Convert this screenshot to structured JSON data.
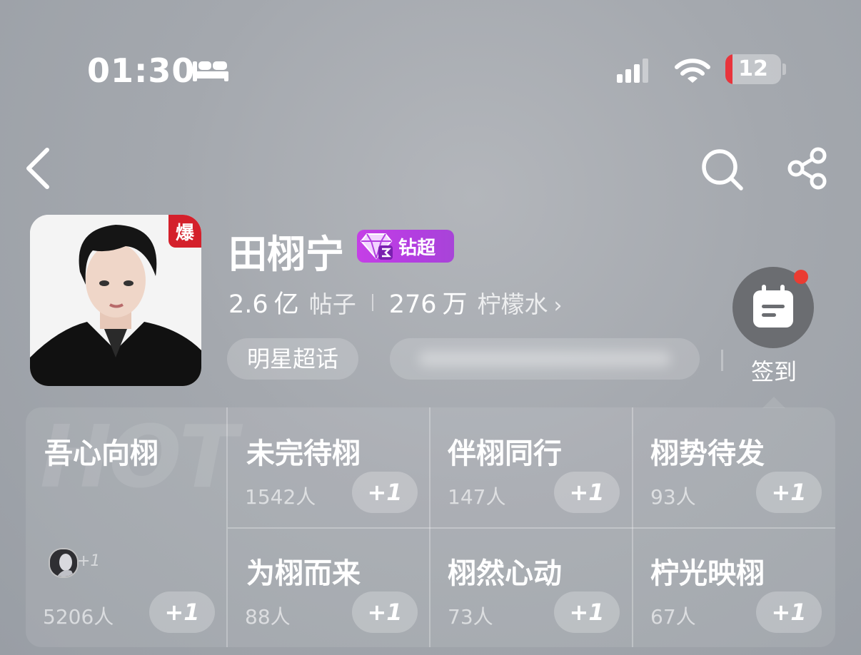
{
  "status_bar": {
    "time": "01:30",
    "battery": "12",
    "icons": [
      "bed-icon",
      "signal-icon",
      "wifi-icon",
      "battery-icon"
    ]
  },
  "nav": {
    "icons": [
      "back-icon",
      "search-icon",
      "share-icon"
    ]
  },
  "topic": {
    "hot_badge": "爆",
    "name": "田栩宁",
    "tier_label": "钻超",
    "posts_count": "2.6",
    "posts_unit": "亿",
    "posts_label": "帖子",
    "followers_count": "276",
    "followers_unit": "万",
    "followers_label": "柠檬水",
    "chevron": "›",
    "category_tag": "明星超话"
  },
  "checkin": {
    "label": "签到",
    "dot_color": "#ea3c32"
  },
  "hot_watermark": "HOT",
  "featured": {
    "title": "吾心向栩",
    "extra": "+1",
    "count": "5206人",
    "button": "+1"
  },
  "groups": [
    {
      "title": "未完待栩",
      "count": "1542人",
      "button": "+1"
    },
    {
      "title": "伴栩同行",
      "count": "147人",
      "button": "+1"
    },
    {
      "title": "栩势待发",
      "count": "93人",
      "button": "+1"
    },
    {
      "title": "为栩而来",
      "count": "88人",
      "button": "+1"
    },
    {
      "title": "栩然心动",
      "count": "73人",
      "button": "+1"
    },
    {
      "title": "柠光映栩",
      "count": "67人",
      "button": "+1"
    }
  ],
  "colors": {
    "hot_red": "#d4202b",
    "tier_purple": "#b23ee0",
    "battery_low": "#e8343c"
  }
}
